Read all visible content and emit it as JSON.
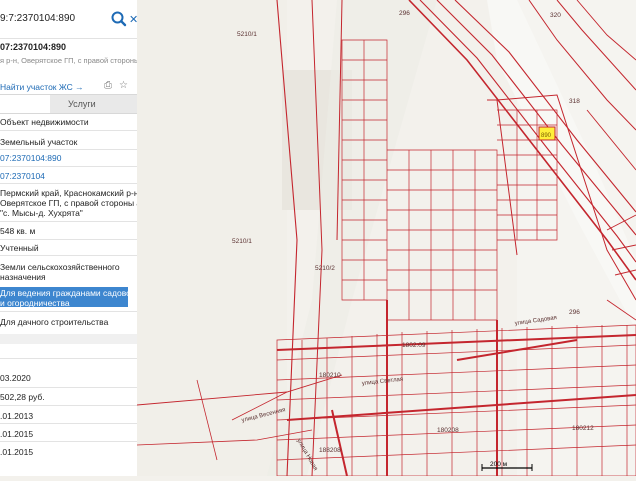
{
  "search": {
    "query": "9:7:2370104:890",
    "icon": "search-icon"
  },
  "card": {
    "cadastral_number": "07:2370104:890",
    "address_short": "я р-н, Оверятское ГП, с правой стороны а/д \"с.",
    "link": "Найти участок ЖС →"
  },
  "tabs": [
    {
      "label": ""
    },
    {
      "label": "Услуги"
    }
  ],
  "fields": {
    "object_type": "Объект недвижимости",
    "kind": "Земельный участок",
    "cad_number": "07:2370104:890",
    "quarter": "07:2370104",
    "address": [
      "Пермский край, Краснокамский р-н,",
      "Оверятское ГП, с правой стороны а/д",
      "\"с. Мысы-д. Хухрята\""
    ],
    "area": "548 кв. м",
    "status": "Учтенный",
    "category": [
      "Земли сельскохозяйственного",
      "назначения"
    ],
    "permitted_use": [
      "Для ведения гражданами садоводства",
      "и огородничества"
    ],
    "use_by_doc": "Для дачного строительства",
    "date1": "03.2020",
    "cost": "502,28 руб.",
    "date2": ".01.2013",
    "date3": ".01.2015",
    "date4": ".01.2015"
  },
  "map": {
    "parcel_labels": [
      "5210/1",
      "5210/1",
      "5210/2",
      "296",
      "296",
      "318",
      "320",
      "1802:09",
      "180210",
      "180208",
      "180212",
      "188208"
    ],
    "street_labels": [
      "улица Садовая",
      "улица Светлая",
      "улица Весенняя",
      "улица Новая"
    ],
    "scale_label": "200 м",
    "highlight_label": "890",
    "colors": {
      "parcel": "#c4262e",
      "highlight": "#ffef3a",
      "panel_highlight": "#3d86cf",
      "link": "#1d6ab5"
    }
  }
}
